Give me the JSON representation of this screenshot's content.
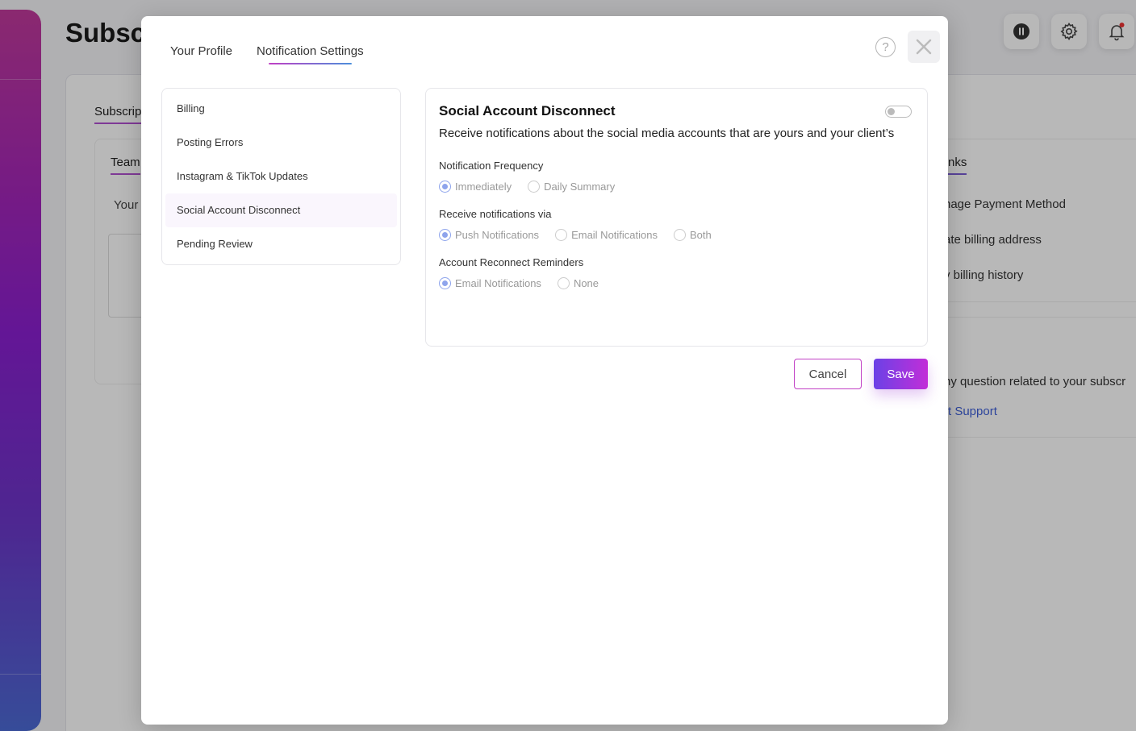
{
  "background": {
    "page_title": "Subsc",
    "tab": "Subscrip",
    "team_tab": "Team",
    "your_text": "Your",
    "links_heading": "nks",
    "links": [
      "nage Payment Method",
      "ate billing address",
      "v billing history"
    ],
    "support_question": "ny question related to your subscr",
    "support_link": "t Support"
  },
  "modal": {
    "tabs": [
      {
        "label": "Your Profile",
        "active": false
      },
      {
        "label": "Notification Settings",
        "active": true
      }
    ],
    "help_icon": "?",
    "categories": [
      {
        "label": "Billing"
      },
      {
        "label": "Posting Errors"
      },
      {
        "label": "Instagram & TikTok Updates"
      },
      {
        "label": "Social Account Disconnect",
        "active": true
      },
      {
        "label": "Pending Review"
      }
    ],
    "detail": {
      "title": "Social Account Disconnect",
      "description": "Receive notifications about the social media accounts that are yours and your client’s",
      "enabled": false,
      "groups": [
        {
          "label": "Notification Frequency",
          "options": [
            "Immediately",
            "Daily Summary"
          ],
          "selected": "Immediately"
        },
        {
          "label": "Receive notifications via",
          "options": [
            "Push Notifications",
            "Email Notifications",
            "Both"
          ],
          "selected": "Push Notifications"
        },
        {
          "label": "Account Reconnect Reminders",
          "options": [
            "Email Notifications",
            "None"
          ],
          "selected": "Email Notifications"
        }
      ]
    },
    "cancel_label": "Cancel",
    "save_label": "Save"
  },
  "colors": {
    "accent_start": "#6b41e6",
    "accent_end": "#c22ed8",
    "radio_selected": "#8ea4ec"
  }
}
